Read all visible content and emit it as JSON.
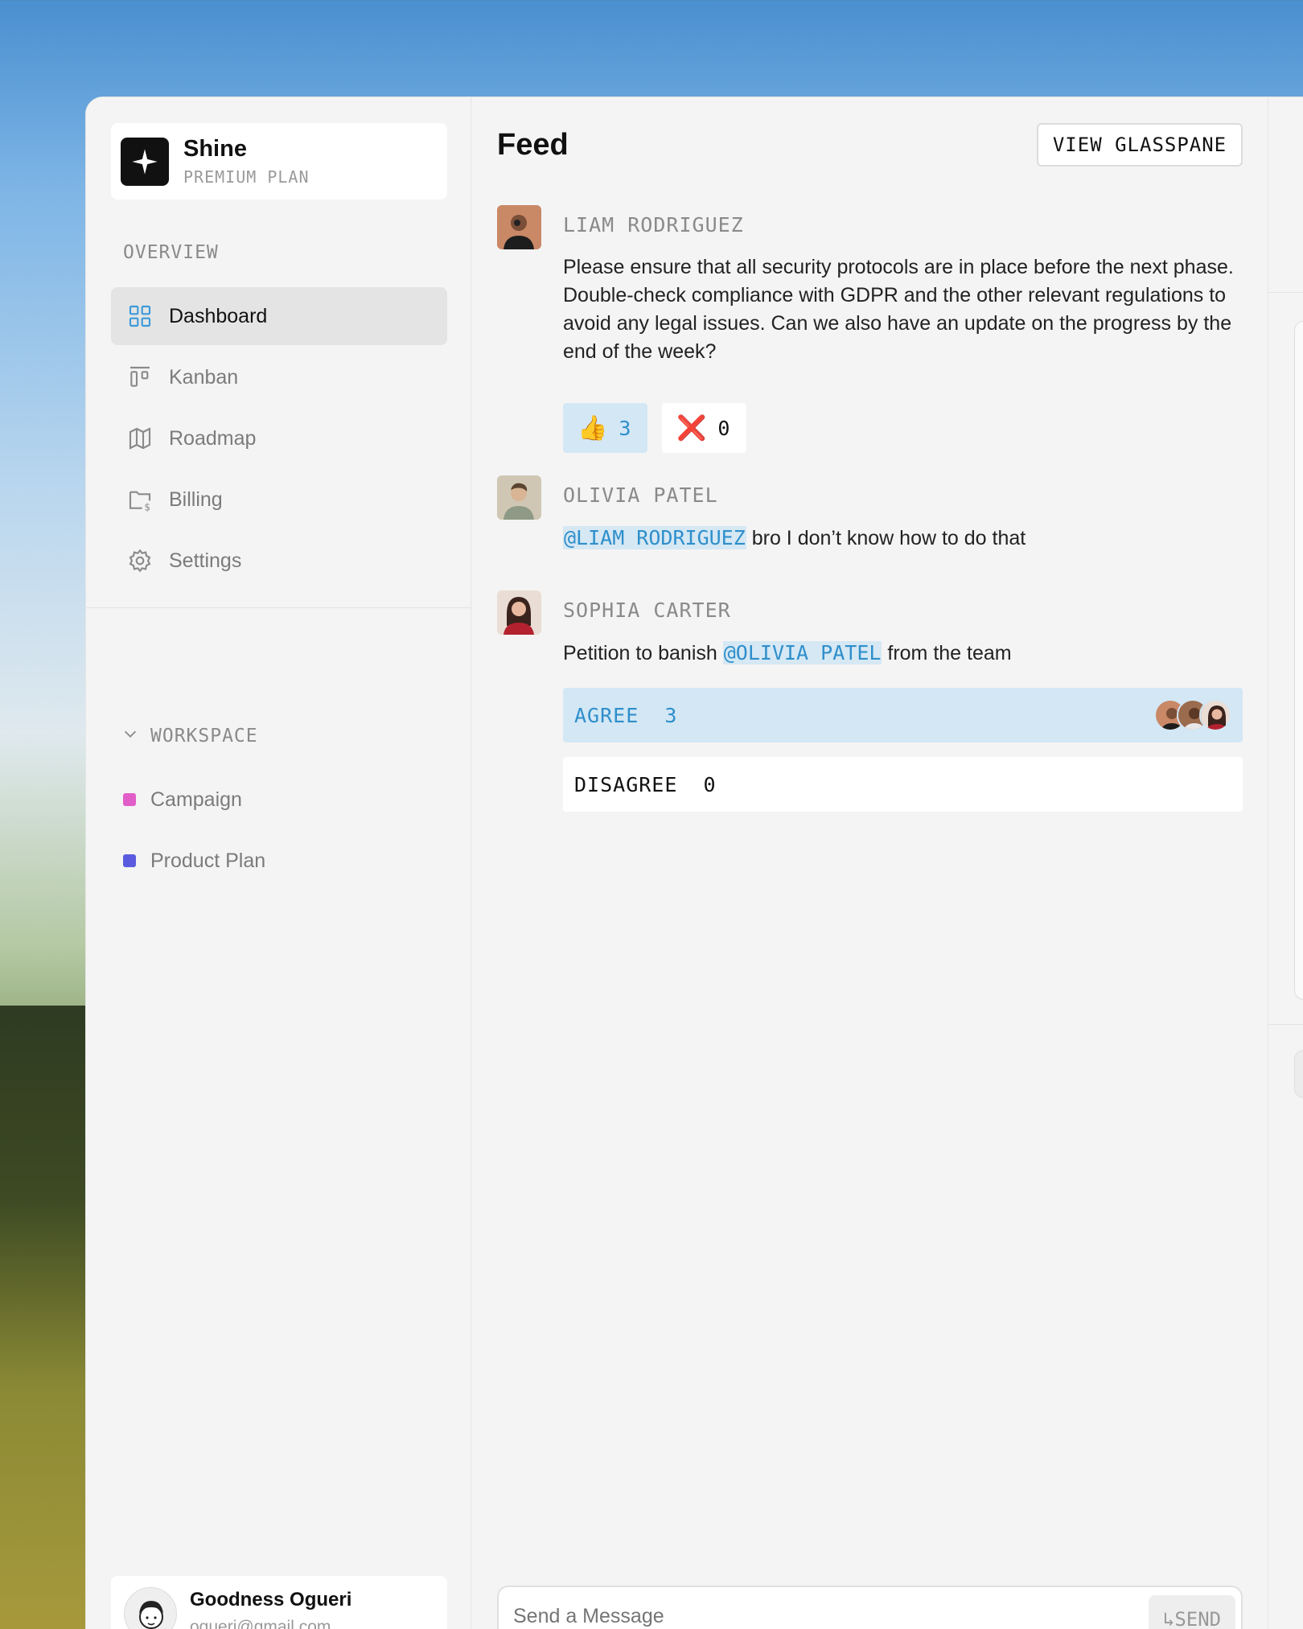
{
  "brand": {
    "name": "Shine",
    "plan": "PREMIUM PLAN"
  },
  "sidebar": {
    "overview_label": "OVERVIEW",
    "items": [
      {
        "label": "Dashboard",
        "icon": "grid-icon",
        "active": true
      },
      {
        "label": "Kanban",
        "icon": "kanban-icon",
        "active": false
      },
      {
        "label": "Roadmap",
        "icon": "map-icon",
        "active": false
      },
      {
        "label": "Billing",
        "icon": "billing-folder-icon",
        "active": false
      },
      {
        "label": "Settings",
        "icon": "gear-icon",
        "active": false
      }
    ],
    "workspace_label": "WORKSPACE",
    "workspace_items": [
      {
        "label": "Campaign",
        "color": "#e15ec8"
      },
      {
        "label": "Product Plan",
        "color": "#5b5be0"
      }
    ]
  },
  "user": {
    "name": "Goodness Ogueri",
    "email": "ogueri@gmail.com"
  },
  "feed": {
    "title": "Feed",
    "view_button": "VIEW GLASSPANE",
    "posts": [
      {
        "author": "LIAM RODRIGUEZ",
        "body": "Please ensure that all security protocols are in place before the next phase. Double-check compliance with GDPR and the other relevant regulations to avoid any legal issues. Can we also have an update on the progress by the end of the week?",
        "reactions": [
          {
            "emoji": "👍",
            "count": "3"
          },
          {
            "emoji": "❌",
            "count": "0"
          }
        ]
      },
      {
        "author": "OLIVIA PATEL",
        "mention": "@LIAM RODRIGUEZ",
        "body_after": " bro I don’t know how to do that"
      },
      {
        "author": "SOPHIA CARTER",
        "body_before": "Petition to banish ",
        "mention": "@OLIVIA PATEL",
        "body_after": " from the team",
        "poll": [
          {
            "label": "AGREE",
            "count": "3"
          },
          {
            "label": "DISAGREE",
            "count": "0"
          }
        ]
      }
    ],
    "composer": {
      "placeholder": "Send a Message",
      "send_label": "↳SEND"
    }
  },
  "colors": {
    "accent": "#2f8fcb",
    "accent_bg": "#d3e7f5"
  }
}
